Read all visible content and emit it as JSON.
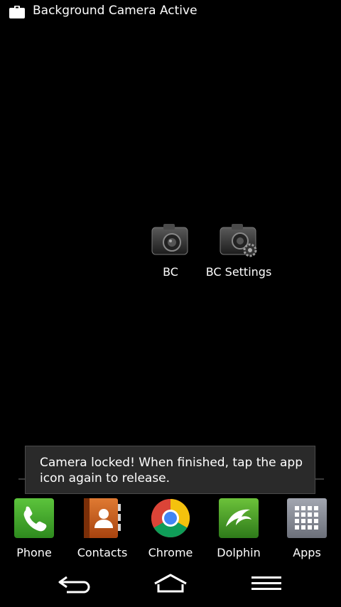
{
  "status_bar": {
    "notification_icon": "clipboard-icon",
    "title": "Background Camera Active"
  },
  "desktop": {
    "apps": [
      {
        "label": "BC",
        "icon": "camera-icon"
      },
      {
        "label": "BC Settings",
        "icon": "camera-settings-icon"
      }
    ]
  },
  "toast": {
    "message": "Camera locked! When finished, tap the app icon again to release."
  },
  "dock": {
    "items": [
      {
        "label": "Phone",
        "icon": "phone-icon"
      },
      {
        "label": "Contacts",
        "icon": "contacts-icon"
      },
      {
        "label": "Chrome",
        "icon": "chrome-icon"
      },
      {
        "label": "Dolphin",
        "icon": "dolphin-icon"
      },
      {
        "label": "Apps",
        "icon": "apps-grid-icon"
      }
    ]
  },
  "nav": {
    "buttons": [
      "back",
      "home",
      "menu"
    ]
  },
  "colors": {
    "background": "#000000",
    "phone_green": "#3fa02c",
    "contacts_orange": "#c4561a",
    "dolphin_green": "#4a9a2a",
    "apps_gray": "#8a8e99"
  }
}
